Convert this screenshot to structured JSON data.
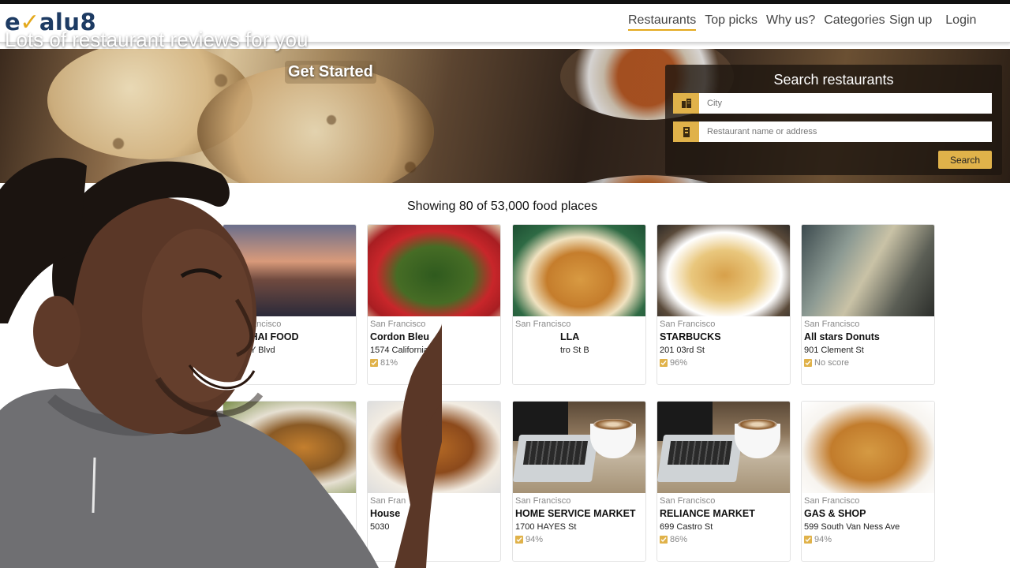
{
  "app": {
    "logo_prefix": "e",
    "logo_check": "✓",
    "logo_suffix": "alu8"
  },
  "nav": {
    "items": [
      {
        "label": "Restaurants",
        "active": true
      },
      {
        "label": "Top picks",
        "active": false
      },
      {
        "label": "Why us?",
        "active": false
      },
      {
        "label": "Categories",
        "active": false
      }
    ],
    "signup": "Sign up",
    "login": "Login"
  },
  "hero": {
    "title": "Lots of restaurant reviews for you",
    "cta": "Get Started"
  },
  "search": {
    "title": "Search restaurants",
    "city_placeholder": "City",
    "name_placeholder": "Restaurant name or address",
    "button": "Search",
    "city_icon": "building-icon",
    "name_icon": "restaurant-icon"
  },
  "listing": {
    "showing": "Showing 80 of 53,000 food places"
  },
  "cards": [
    {
      "city": "San Francisco",
      "name": "N'S THAI FOOD",
      "address": "GEARY Blvd",
      "score": "%",
      "image": "city-icon"
    },
    {
      "city": "San Francisco",
      "name": "Cordon Bleu",
      "address": "1574 California St",
      "score": "81%",
      "image": "greens-icon"
    },
    {
      "city": "San Francisco",
      "name": "LLA",
      "address": "tro St B",
      "score": "",
      "image": "fish-icon"
    },
    {
      "city": "San Francisco",
      "name": "STARBUCKS",
      "address": "201 03rd St",
      "score": "96%",
      "image": "fries-icon"
    },
    {
      "city": "San Francisco",
      "name": "All stars Donuts",
      "address": "901 Clement St",
      "score": "No score",
      "image": "shop-icon"
    },
    {
      "city": "",
      "name": "",
      "address": "",
      "score": "",
      "image": "burger-icon"
    },
    {
      "city": "San Fran",
      "name": "House",
      "address": "5030",
      "score": "",
      "image": "chicken-icon"
    },
    {
      "city": "San Francisco",
      "name": "HOME SERVICE MARKET",
      "address": "1700 HAYES St",
      "score": "94%",
      "image": "laptop-coffee-icon"
    },
    {
      "city": "San Francisco",
      "name": "RELIANCE MARKET",
      "address": "699 Castro St",
      "score": "86%",
      "image": "laptop-coffee-icon"
    },
    {
      "city": "San Francisco",
      "name": "GAS & SHOP",
      "address": "599 South Van Ness Ave",
      "score": "94%",
      "image": "fried-chicken-icon"
    }
  ],
  "colors": {
    "accent": "#e0b24a",
    "logo": "#1d3b63"
  }
}
